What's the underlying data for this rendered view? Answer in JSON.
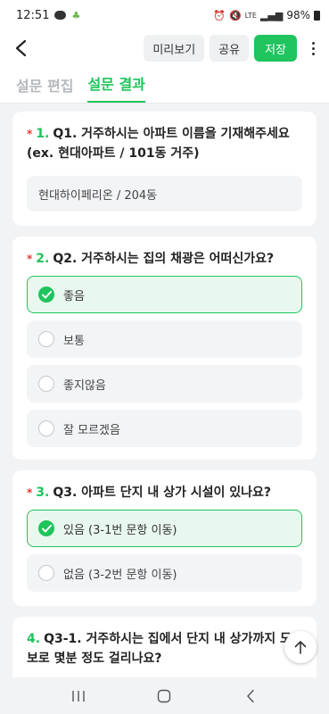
{
  "status": {
    "time": "12:51",
    "battery": "98%",
    "network": "LTE"
  },
  "toolbar": {
    "preview": "미리보기",
    "share": "공유",
    "save": "저장"
  },
  "tabs": [
    {
      "label": "설문 편집",
      "active": false
    },
    {
      "label": "설문 결과",
      "active": true
    }
  ],
  "questions": [
    {
      "required": "*",
      "number": "1.",
      "title": "Q1. 거주하시는 아파트 이름을 기재해주세요 (ex. 현대아파트 / 101동 거주)",
      "answer": "현대하이페리온 / 204동"
    },
    {
      "required": "*",
      "number": "2.",
      "title": "Q2. 거주하시는 집의 채광은 어떠신가요?",
      "options": [
        {
          "label": "좋음",
          "selected": true
        },
        {
          "label": "보통",
          "selected": false
        },
        {
          "label": "좋지않음",
          "selected": false
        },
        {
          "label": "잘 모르겠음",
          "selected": false
        }
      ]
    },
    {
      "required": "*",
      "number": "3.",
      "title": "Q3. 아파트 단지 내 상가 시설이 있나요?",
      "options": [
        {
          "label": "있음 (3-1번 문항 이동)",
          "selected": true
        },
        {
          "label": "없음 (3-2번 문항 이동)",
          "selected": false
        }
      ]
    },
    {
      "number": "4.",
      "title": "Q3-1. 거주하시는 집에서 단지 내 상가까지 도보로 몇분 정도 걸리나요?"
    }
  ],
  "colors": {
    "accent": "#1fc45d",
    "required": "#e53935"
  }
}
